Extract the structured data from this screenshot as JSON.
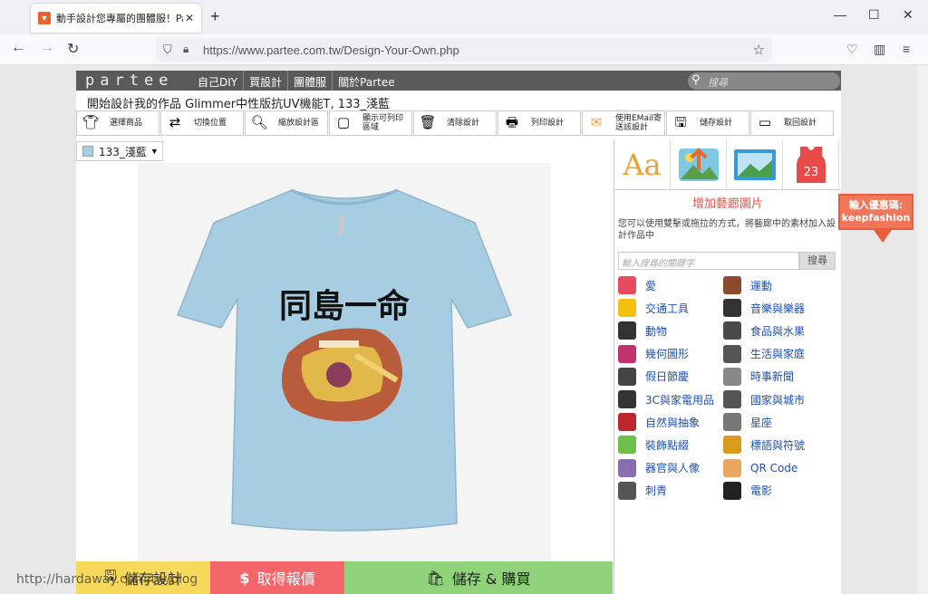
{
  "browser": {
    "tab_title": "動手設計您專屬的團體服！Parte",
    "tab_favicon": "partee-favicon",
    "url": "https://www.partee.com.tw/Design-Your-Own.php"
  },
  "site": {
    "logo": "partee",
    "nav": [
      "自己DIY",
      "買設計",
      "團體服",
      "關於Partee"
    ],
    "search_placeholder": "搜尋"
  },
  "design_title": "開始設計我的作品 Glimmer中性版抗UV機能T, 133_淺藍",
  "toolbar": [
    {
      "label": "選擇商品",
      "icon": "tshirt-icon"
    },
    {
      "label": "切換位置",
      "icon": "tshirt-swap-icon"
    },
    {
      "label": "縮放設計區",
      "icon": "magnify-icon"
    },
    {
      "label": "顯示可列印區域",
      "icon": "print-area-icon"
    },
    {
      "label": "清除設計",
      "icon": "trash-icon"
    },
    {
      "label": "列印設計",
      "icon": "printer-icon"
    },
    {
      "label": "使用EMail寄送該設計",
      "icon": "email-icon"
    },
    {
      "label": "儲存設計",
      "icon": "save-icon"
    },
    {
      "label": "取回設計",
      "icon": "load-icon"
    }
  ],
  "color_select": {
    "label": "133_淺藍",
    "swatch": "#a7cde3"
  },
  "shirt": {
    "text": "同島一命",
    "color": "#a7cde3"
  },
  "bottom_bar": {
    "save": "儲存設計",
    "quote": "取得報價",
    "buy": "儲存 & 購買"
  },
  "right_panel": {
    "heading": "增加藝廊圖片",
    "desc": "您可以使用雙擊或拖拉的方式，將藝廊中的素材加入設計作品中",
    "search_placeholder": "輸入搜尋的關鍵字",
    "search_button": "搜尋",
    "tabs": [
      "text-tab",
      "upload-image-tab",
      "gallery-tab",
      "jersey-tab"
    ],
    "tab_text_glyph": "Aa",
    "tab_jersey_number": "23",
    "categories": [
      {
        "label": "愛",
        "color": "#e84a5f"
      },
      {
        "label": "運動",
        "color": "#8b4a2b"
      },
      {
        "label": "交通工具",
        "color": "#f2c10d"
      },
      {
        "label": "音樂與樂器",
        "color": "#333333"
      },
      {
        "label": "動物",
        "color": "#333333"
      },
      {
        "label": "食品與水果",
        "color": "#4a4a4a"
      },
      {
        "label": "幾何圖形",
        "color": "#c2326e"
      },
      {
        "label": "生活與家庭",
        "color": "#555555"
      },
      {
        "label": "假日節慶",
        "color": "#444444"
      },
      {
        "label": "時事新聞",
        "color": "#888888"
      },
      {
        "label": "3C與家電用品",
        "color": "#333333"
      },
      {
        "label": "國家與城市",
        "color": "#555555"
      },
      {
        "label": "自然與抽象",
        "color": "#c0262e"
      },
      {
        "label": "星座",
        "color": "#777777"
      },
      {
        "label": "裝飾點綴",
        "color": "#6fc04a"
      },
      {
        "label": "標語與符號",
        "color": "#d99a1e"
      },
      {
        "label": "器官與人像",
        "color": "#8a6fb0"
      },
      {
        "label": "QR Code",
        "color": "#e8a65e"
      },
      {
        "label": "刺青",
        "color": "#555555"
      },
      {
        "label": "電影",
        "color": "#222222"
      }
    ]
  },
  "promo": {
    "line1": "輸入優惠碼:",
    "line2": "keepfashion"
  },
  "watermark": "http://hardaway.com.tw/blog"
}
